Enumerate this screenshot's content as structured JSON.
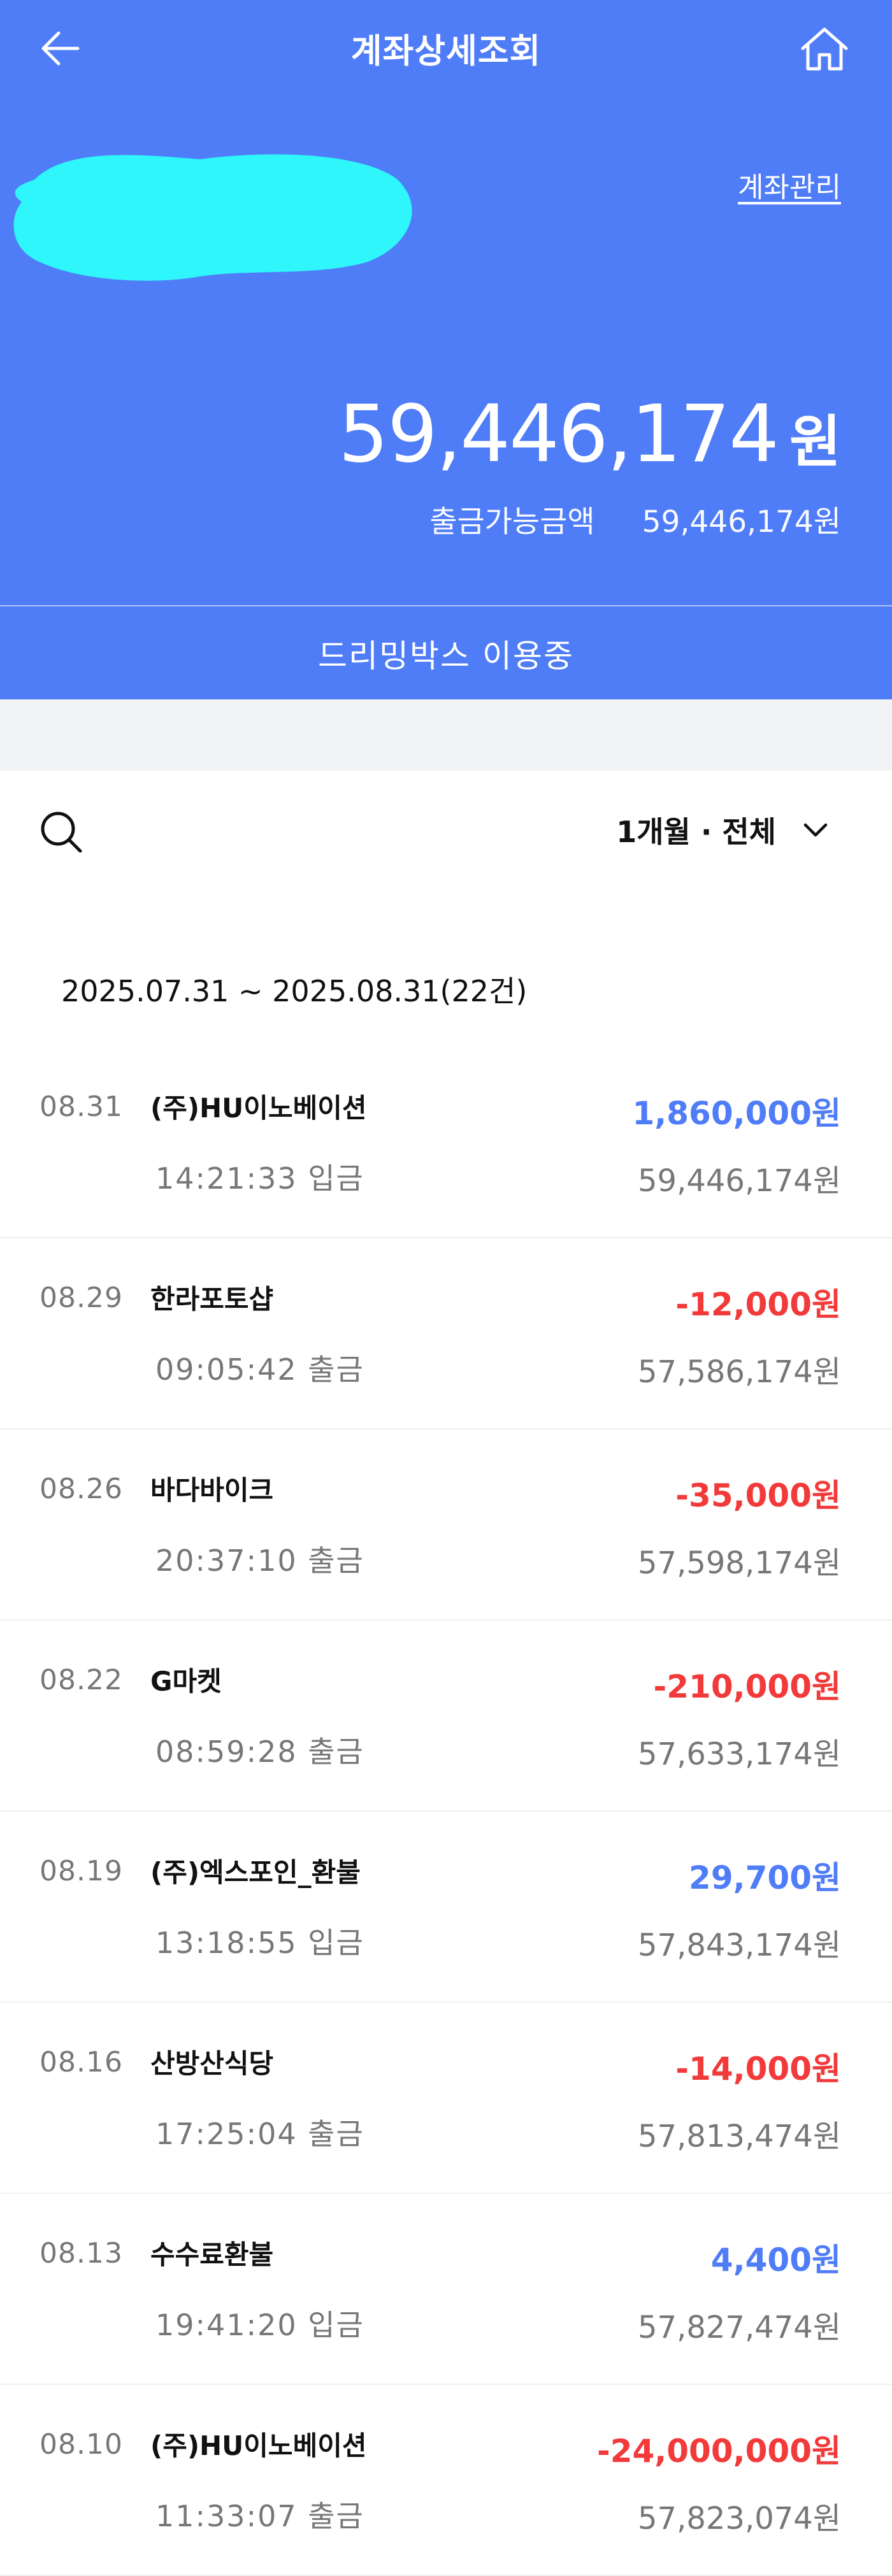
{
  "header": {
    "title": "계좌상세조회",
    "manage_link": "계좌관리"
  },
  "balance": {
    "amount": "59,446,174",
    "unit": "원",
    "available_label": "출금가능금액",
    "available_value": "59,446,174원"
  },
  "status_text": "드리밍박스 이용중",
  "filter": {
    "label": "1개월 · 전체"
  },
  "range": "2025.07.31 ~ 2025.08.31(22건)",
  "colors": {
    "brand_blue": "#4f7cf7",
    "deposit": "#4f7cf7",
    "withdrawal": "#f23a3a"
  },
  "icons": [
    "back-arrow-icon",
    "home-icon",
    "search-icon",
    "chevron-down-icon"
  ],
  "transactions": [
    {
      "date": "08.31",
      "name": "(주)HU이노베이션",
      "time": "14:21:33 입금",
      "amount": "1,860,000원",
      "type": "plus",
      "balance_after": "59,446,174원"
    },
    {
      "date": "08.29",
      "name": "한라포토샵",
      "time": "09:05:42 출금",
      "amount": "-12,000원",
      "type": "minus",
      "balance_after": "57,586,174원"
    },
    {
      "date": "08.26",
      "name": "바다바이크",
      "time": "20:37:10 출금",
      "amount": "-35,000원",
      "type": "minus",
      "balance_after": "57,598,174원"
    },
    {
      "date": "08.22",
      "name": "G마켓",
      "time": "08:59:28 출금",
      "amount": "-210,000원",
      "type": "minus",
      "balance_after": "57,633,174원"
    },
    {
      "date": "08.19",
      "name": "(주)엑스포인_환불",
      "time": "13:18:55 입금",
      "amount": "29,700원",
      "type": "plus",
      "balance_after": "57,843,174원"
    },
    {
      "date": "08.16",
      "name": "산방산식당",
      "time": "17:25:04 출금",
      "amount": "-14,000원",
      "type": "minus",
      "balance_after": "57,813,474원"
    },
    {
      "date": "08.13",
      "name": "수수료환불",
      "time": "19:41:20 입금",
      "amount": "4,400원",
      "type": "plus",
      "balance_after": "57,827,474원"
    },
    {
      "date": "08.10",
      "name": "(주)HU이노베이션",
      "time": "11:33:07 출금",
      "amount": "-24,000,000원",
      "type": "minus",
      "balance_after": "57,823,074원"
    }
  ]
}
